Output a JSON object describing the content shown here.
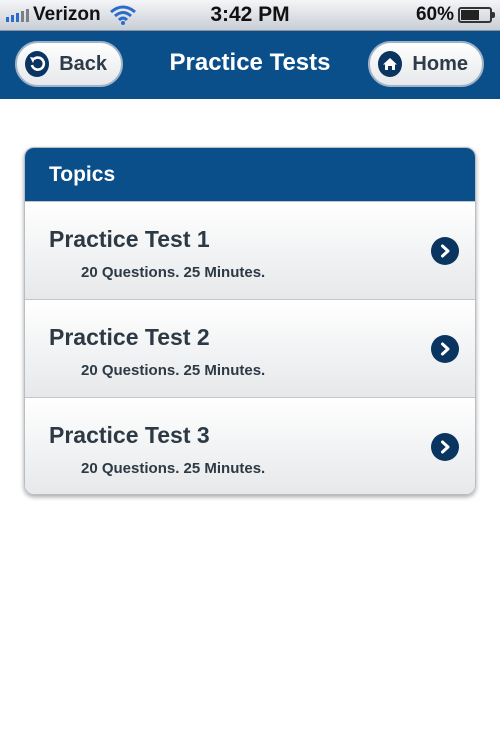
{
  "status_bar": {
    "carrier": "Verizon",
    "time": "3:42 PM",
    "battery": "60%",
    "battery_level": 0.6
  },
  "nav": {
    "title": "Practice Tests",
    "back_label": "Back",
    "home_label": "Home"
  },
  "topics": {
    "header": "Topics",
    "items": [
      {
        "title": "Practice Test 1",
        "subtitle": "20 Questions. 25 Minutes."
      },
      {
        "title": "Practice Test 2",
        "subtitle": "20 Questions. 25 Minutes."
      },
      {
        "title": "Practice Test 3",
        "subtitle": "20 Questions. 25 Minutes."
      }
    ]
  },
  "colors": {
    "nav_blue": "#0b4f8a",
    "icon_navy": "#0a3560",
    "text_dark": "#2d3a45"
  }
}
